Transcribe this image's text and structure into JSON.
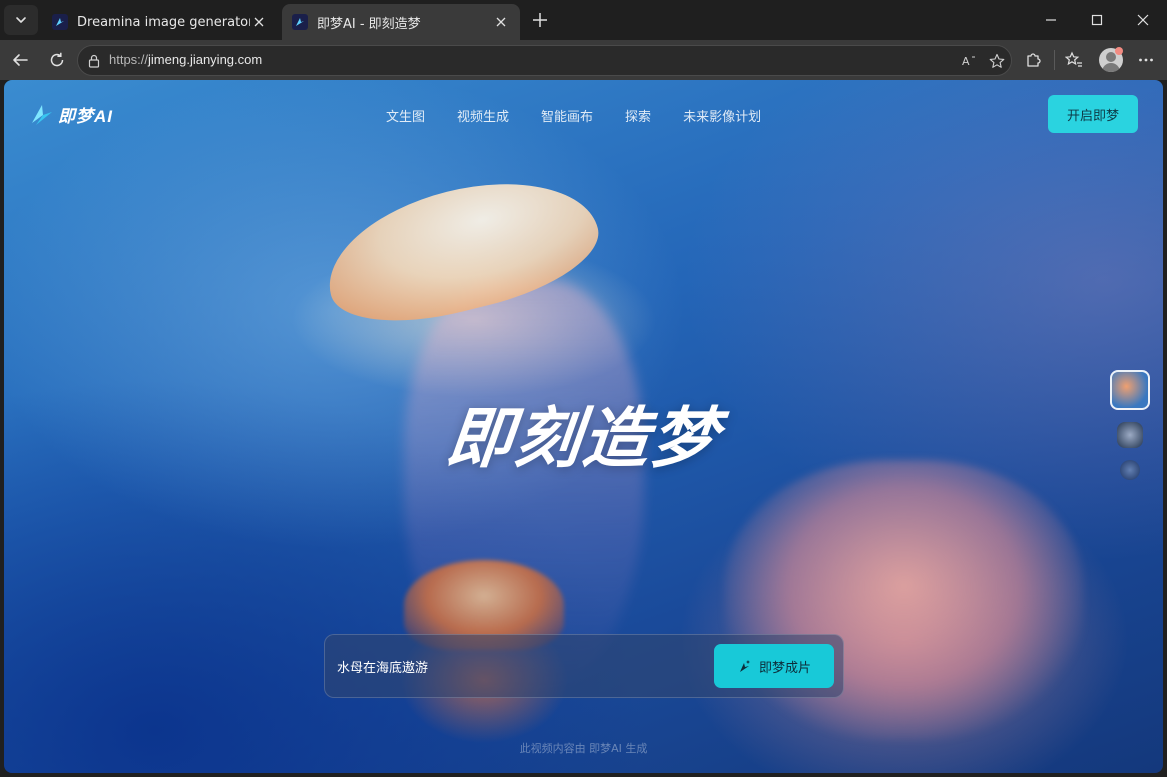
{
  "browser": {
    "tabs": [
      {
        "title": "Dreamina image generator & video generator",
        "active": false
      },
      {
        "title": "即梦AI - 即刻造梦",
        "active": true
      }
    ],
    "url_protocol": "https://",
    "url_host": "jimeng.jianying.com"
  },
  "header": {
    "logo_text": "即梦AI",
    "nav": [
      "文生图",
      "视频生成",
      "智能画布",
      "探索",
      "未来影像计划"
    ],
    "cta_label": "开启即梦"
  },
  "hero": {
    "title": "即刻造梦"
  },
  "prompt": {
    "text": "水母在海底遨游",
    "button_label": "即梦成片"
  },
  "footer": {
    "note": "此视频内容由 即梦AI 生成"
  },
  "colors": {
    "accent": "#18c9d8",
    "chrome_dark": "#1f1f1f",
    "chrome_toolbar": "#3a3a3a"
  }
}
